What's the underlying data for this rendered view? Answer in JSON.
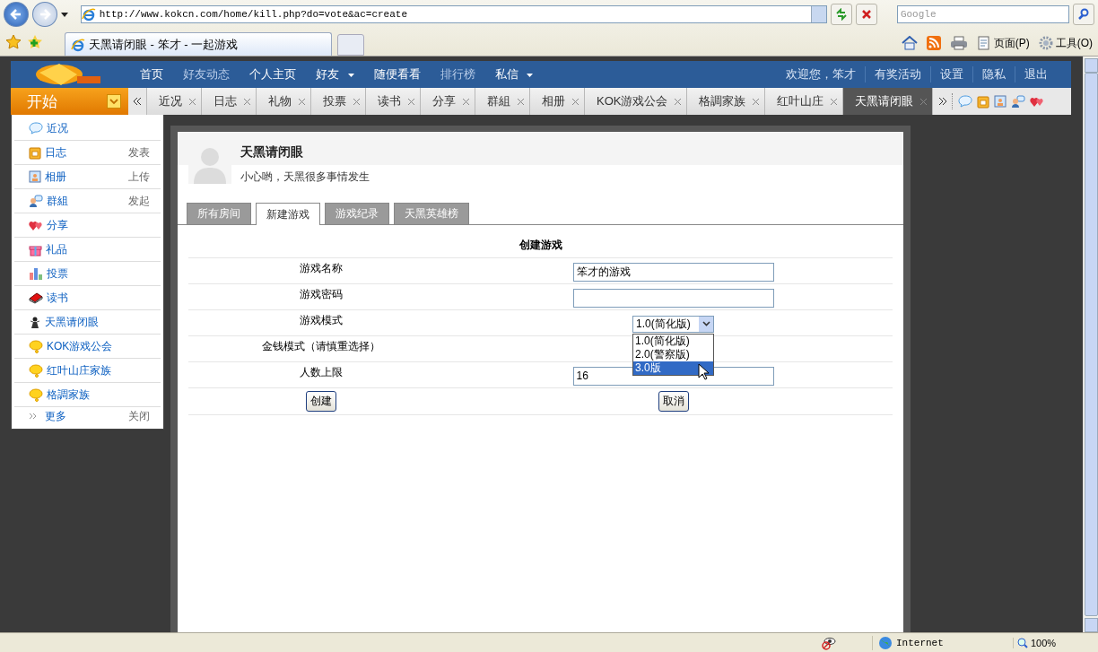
{
  "browser": {
    "address": "http://www.kokcn.com/home/kill.php?do=vote&ac=create",
    "search_placeholder": "Google",
    "tab_title": "天黑请闭眼 - 笨才 - 一起游戏",
    "toolbar": [
      "页面(P)",
      "工具(O)"
    ]
  },
  "site_nav": {
    "left": [
      {
        "label": "首页",
        "menu": false,
        "dim": false
      },
      {
        "label": "好友动态",
        "menu": false,
        "dim": true
      },
      {
        "label": "个人主页",
        "menu": false,
        "dim": false
      },
      {
        "label": "好友",
        "menu": true,
        "dim": false
      },
      {
        "label": "随便看看",
        "menu": false,
        "dim": false
      },
      {
        "label": "排行榜",
        "menu": false,
        "dim": true
      },
      {
        "label": "私信",
        "menu": true,
        "dim": false
      }
    ],
    "right": [
      "欢迎您，笨才",
      "有奖活动",
      "设置",
      "隐私",
      "退出"
    ]
  },
  "start_label": "开始",
  "tabs": [
    {
      "label": "近况",
      "selected": false
    },
    {
      "label": "日志",
      "selected": false
    },
    {
      "label": "礼物",
      "selected": false
    },
    {
      "label": "投票",
      "selected": false
    },
    {
      "label": "读书",
      "selected": false
    },
    {
      "label": "分享",
      "selected": false
    },
    {
      "label": "群組",
      "selected": false
    },
    {
      "label": "相册",
      "selected": false
    },
    {
      "label": "KOK游戏公会",
      "selected": false
    },
    {
      "label": "格調家族",
      "selected": false
    },
    {
      "label": "红叶山庄",
      "selected": false
    },
    {
      "label": "天黑请闭眼",
      "selected": true
    }
  ],
  "start_menu": {
    "items": [
      {
        "label": "近况"
      },
      {
        "label": "日志",
        "action": "发表"
      },
      {
        "label": "相册",
        "action": "上传"
      },
      {
        "label": "群組",
        "action": "发起"
      },
      {
        "label": "分享"
      },
      {
        "label": "礼品"
      },
      {
        "label": "投票"
      },
      {
        "label": "读书"
      },
      {
        "label": "天黑请闭眼"
      },
      {
        "label": "KOK游戏公会"
      },
      {
        "label": "红叶山庄家族"
      },
      {
        "label": "格調家族"
      }
    ],
    "more": "更多",
    "close": "关闭"
  },
  "profile": {
    "title": "天黑请闭眼",
    "subtitle": "小心哟，天黑很多事情发生"
  },
  "page_tabs": [
    {
      "label": "所有房间",
      "selected": false
    },
    {
      "label": "新建游戏",
      "selected": true
    },
    {
      "label": "游戏纪录",
      "selected": false
    },
    {
      "label": "天黑英雄榜",
      "selected": false
    }
  ],
  "form": {
    "heading": "创建游戏",
    "rows": [
      {
        "label": "游戏名称",
        "kind": "text",
        "value": "笨才的游戏"
      },
      {
        "label": "游戏密码",
        "kind": "text"
      },
      {
        "label": "游戏模式",
        "kind": "select",
        "value": "1.0(简化版)",
        "expanded": true,
        "options": [
          {
            "label": "1.0(简化版)",
            "highlighted": false
          },
          {
            "label": "2.0(警察版)",
            "highlighted": false
          },
          {
            "label": "3.0版",
            "highlighted": true
          }
        ]
      },
      {
        "label": "金钱模式（请慎重选择）",
        "kind": "none"
      },
      {
        "label": "人数上限",
        "kind": "text",
        "value": "16"
      }
    ],
    "buttons": [
      "创建",
      "取消"
    ]
  },
  "status": {
    "zone": "Internet",
    "zoom": "100%"
  }
}
